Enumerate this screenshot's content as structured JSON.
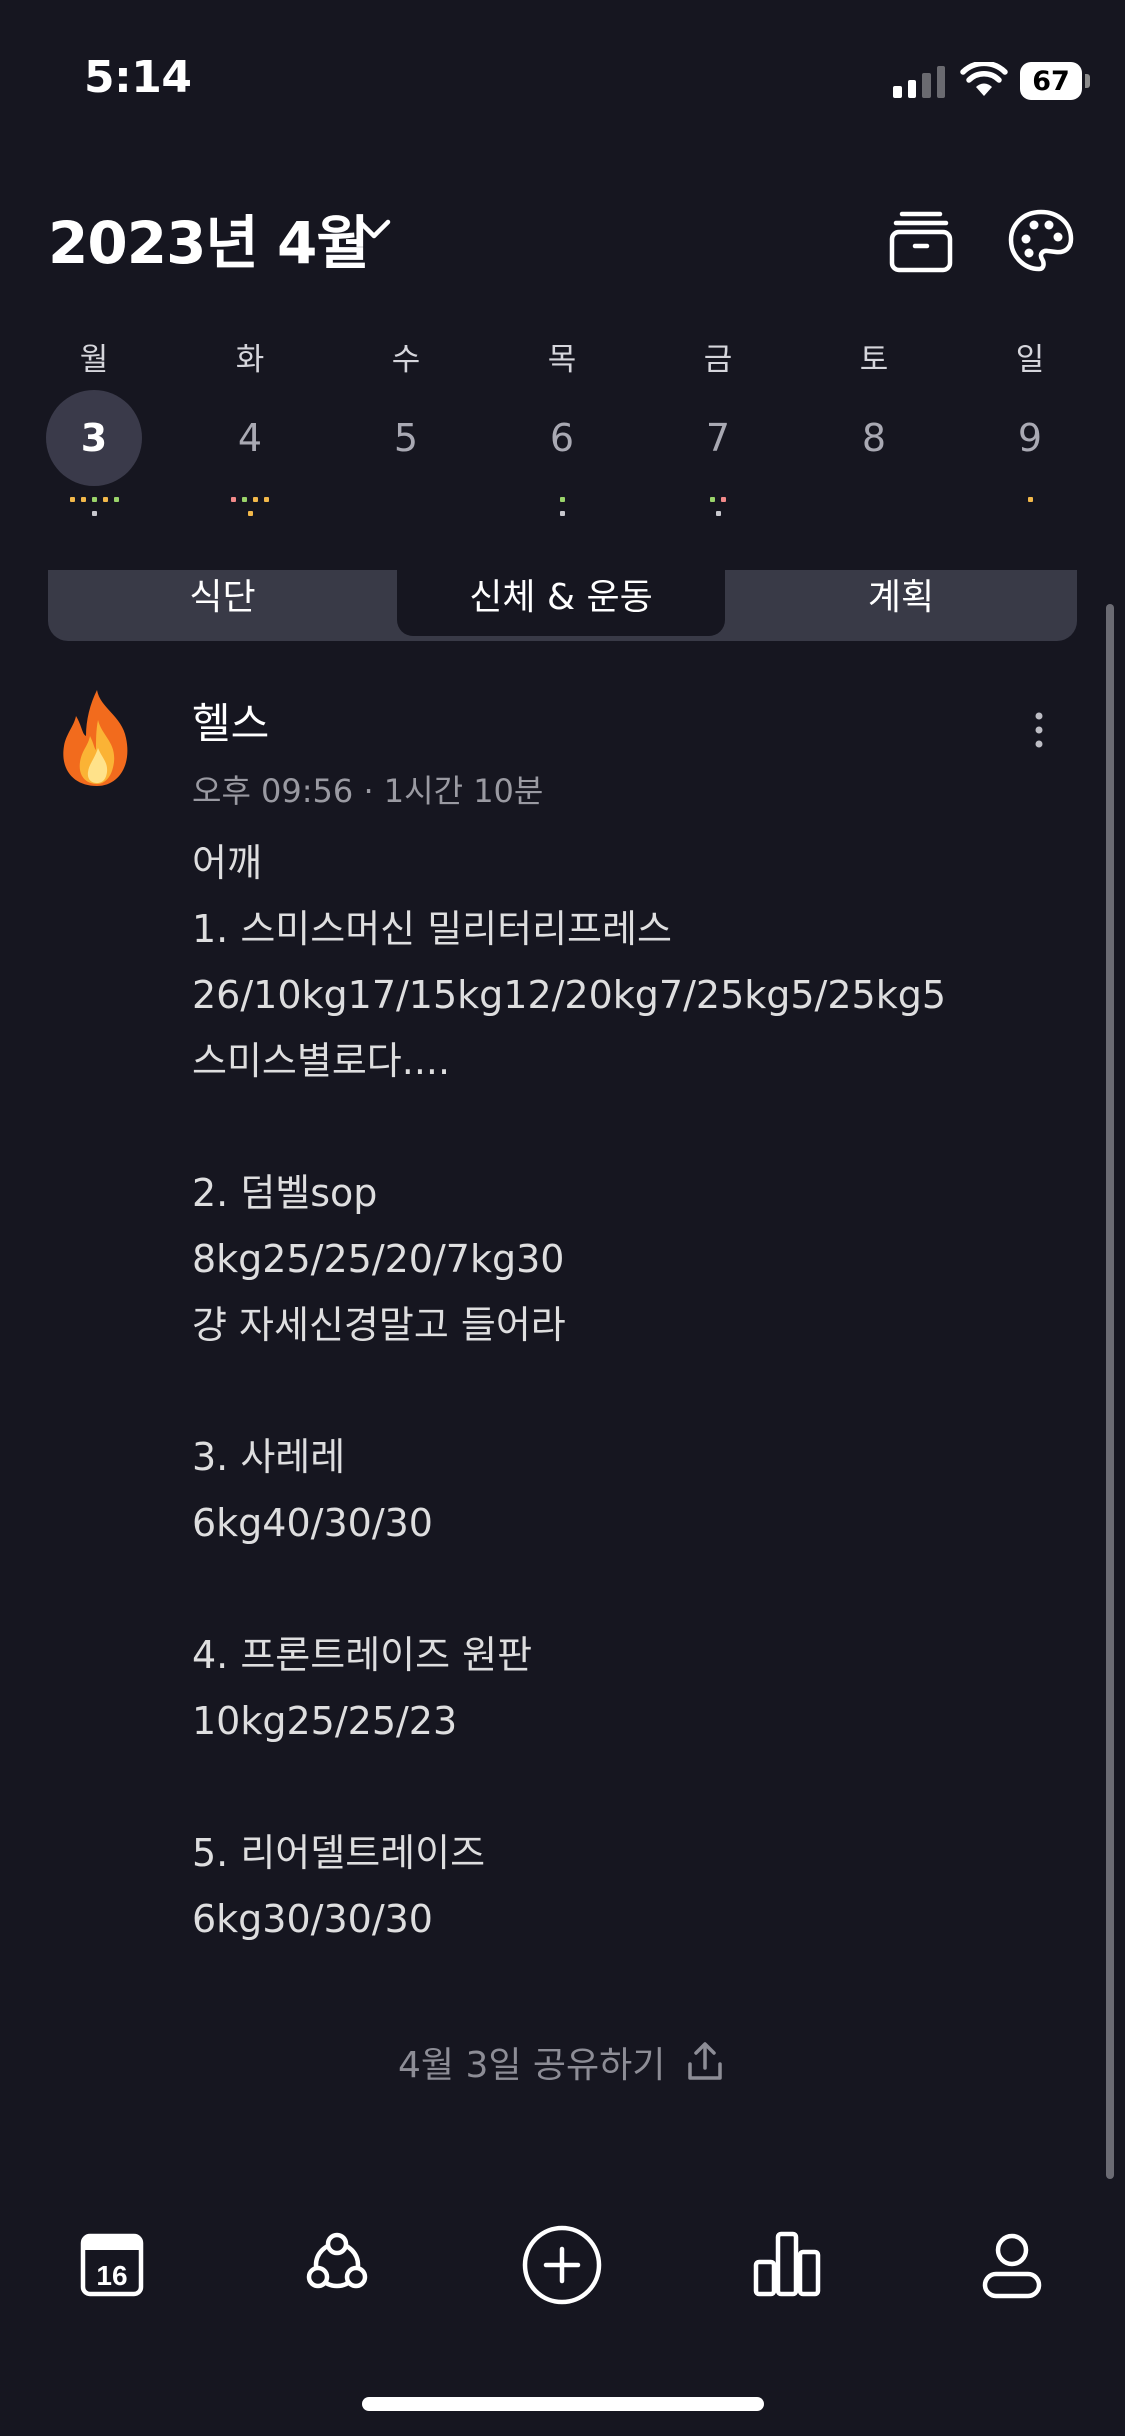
{
  "status_bar": {
    "time": "5:14",
    "battery": "67"
  },
  "header": {
    "title": "2023년 4월"
  },
  "week": [
    {
      "weekday": "월",
      "day": "3",
      "selected": true,
      "dots": [
        "#f2b84a",
        "#f2b84a",
        "#9ad46a",
        "#f2b84a",
        "#9ad46a",
        "#c8c8ce"
      ]
    },
    {
      "weekday": "화",
      "day": "4",
      "selected": false,
      "dots": [
        "#f28a8a",
        "#9ad46a",
        "#f2b84a",
        "#f2b84a",
        "#f2b84a"
      ]
    },
    {
      "weekday": "수",
      "day": "5",
      "selected": false,
      "dots": []
    },
    {
      "weekday": "목",
      "day": "6",
      "selected": false,
      "dots": [
        "#9ad46a",
        "#c8c8ce"
      ]
    },
    {
      "weekday": "금",
      "day": "7",
      "selected": false,
      "dots": [
        "#9ad46a",
        "#f28a8a",
        "#c8c8ce"
      ]
    },
    {
      "weekday": "토",
      "day": "8",
      "selected": false,
      "dots": []
    },
    {
      "weekday": "일",
      "day": "9",
      "selected": false,
      "dots": [
        "#f2b84a"
      ]
    }
  ],
  "tabs": [
    {
      "label": "식단",
      "active": false
    },
    {
      "label": "신체 & 운동",
      "active": true
    },
    {
      "label": "계획",
      "active": false
    }
  ],
  "entry": {
    "emoji": "fire-emoji",
    "title": "헬스",
    "meta": "오후 09:56 · 1시간 10분",
    "body": "어깨\n1. 스미스머신 밀리터리프레스\n26/10kg17/15kg12/20kg7/25kg5/25kg5\n스미스별로다....\n\n2. 덤벨sop\n8kg25/25/20/7kg30\n걍 자세신경말고 들어라\n\n3. 사레레\n6kg40/30/30\n\n4. 프론트레이즈 원판\n10kg25/25/23\n\n5. 리어델트레이즈\n6kg30/30/30"
  },
  "share_label": "4월 3일 공유하기",
  "tab_bar": {
    "calendar_day": "16",
    "items": [
      "calendar-icon",
      "community-icon",
      "add-icon",
      "stats-icon",
      "profile-icon"
    ]
  },
  "colors": {
    "background": "#161620",
    "segment": "#393a47",
    "selected_day": "#3a3a4a"
  }
}
